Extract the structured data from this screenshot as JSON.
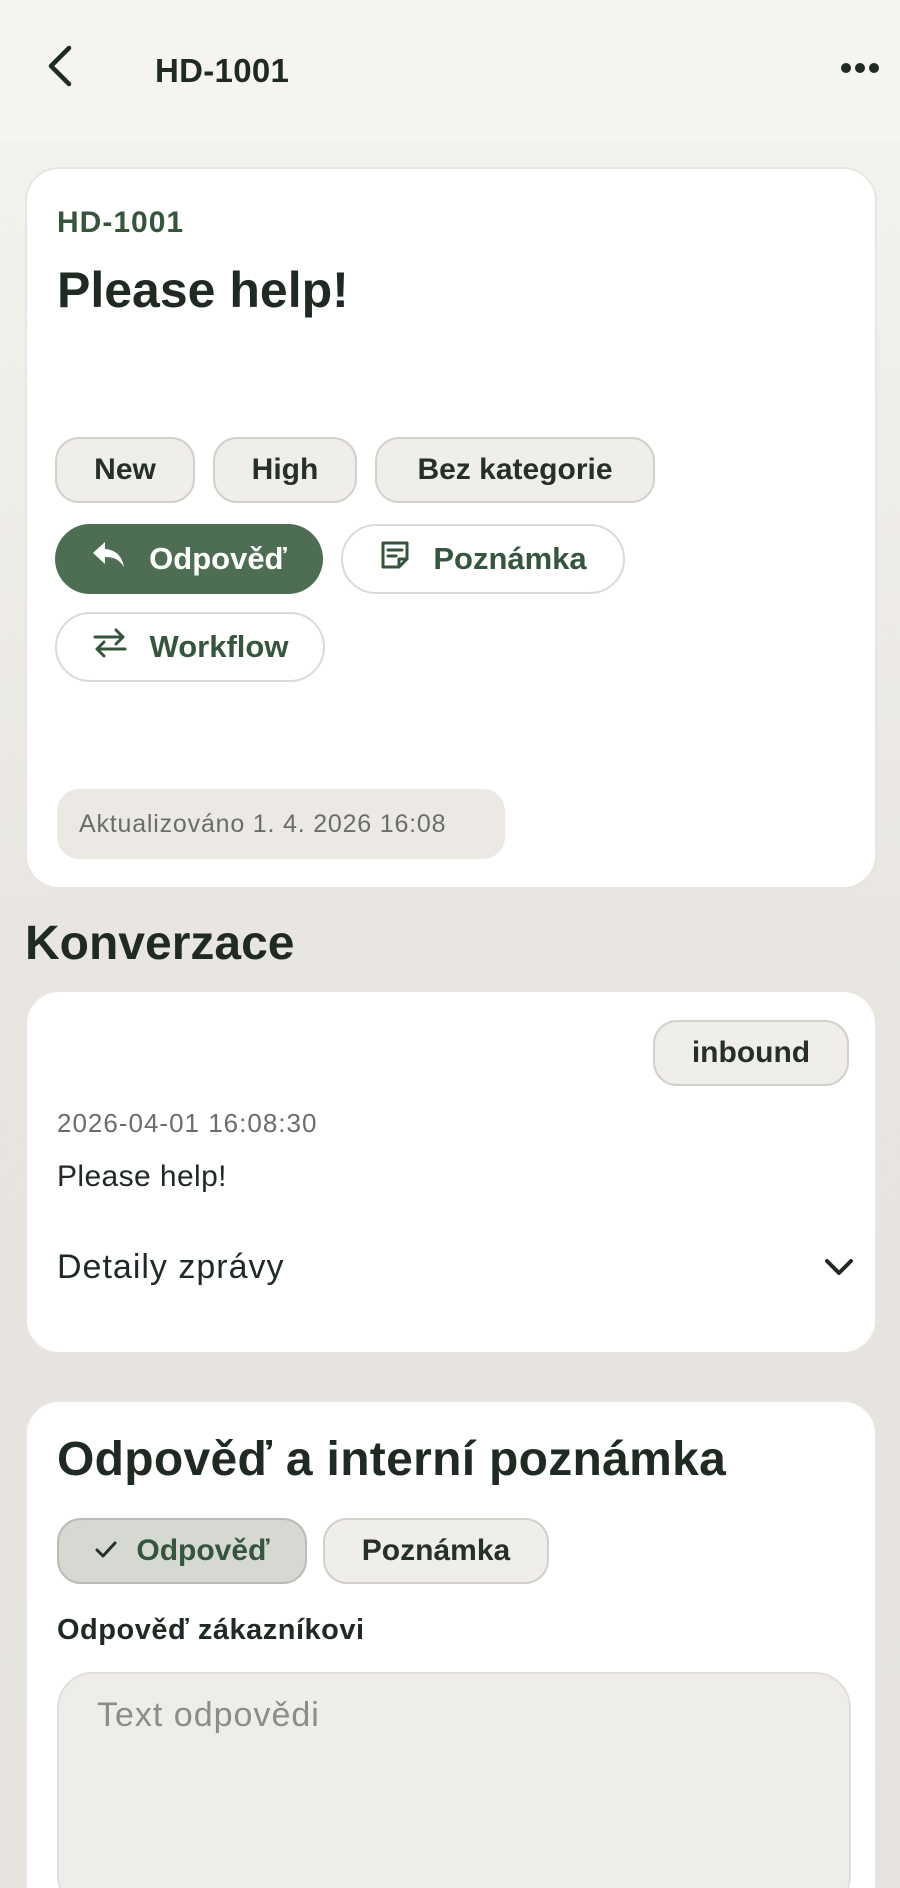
{
  "header": {
    "title": "HD-1001",
    "back_icon": "chevron-left-icon",
    "more_icon": "more-horizontal-icon"
  },
  "ticket": {
    "id": "HD-1001",
    "title": "Please help!",
    "status": "New",
    "priority": "High",
    "category": "Bez kategorie",
    "actions": {
      "reply": "Odpověď",
      "note": "Poznámka",
      "workflow": "Workflow"
    },
    "updated": "Aktualizováno 1. 4. 2026 16:08"
  },
  "conversation": {
    "heading": "Konverzace",
    "message": {
      "direction": "inbound",
      "timestamp": "2026-04-01 16:08:30",
      "body": "Please help!",
      "details_label": "Detaily zprávy"
    }
  },
  "reply_form": {
    "title": "Odpověď a interní poznámka",
    "tabs": {
      "reply": "Odpověď",
      "note": "Poznámka",
      "active": "reply"
    },
    "field_label": "Odpověď zákazníkovi",
    "placeholder": "Text odpovědi",
    "value": ""
  },
  "colors": {
    "accent": "#4d6e52",
    "accent_text": "#35563c",
    "background": "#eae7e2",
    "card": "#ffffff"
  }
}
